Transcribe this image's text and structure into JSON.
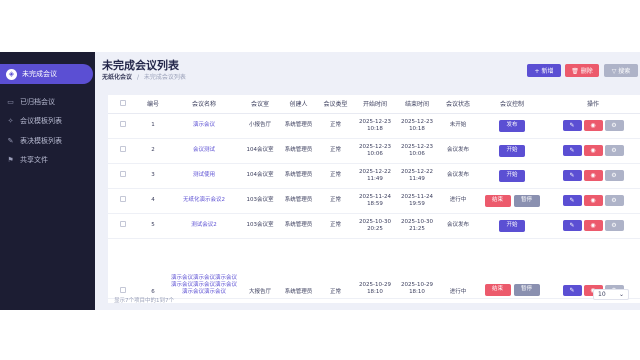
{
  "sidebar": {
    "items": [
      {
        "label": "未完成会议",
        "icon": "shield-icon",
        "glyph": "◈"
      },
      {
        "label": "已归档会议",
        "icon": "archive-icon",
        "glyph": "▭"
      },
      {
        "label": "会议模板列表",
        "icon": "bulb-icon",
        "glyph": "✧"
      },
      {
        "label": "表决模板列表",
        "icon": "vote-icon",
        "glyph": "✎"
      },
      {
        "label": "共享文件",
        "icon": "share-icon",
        "glyph": "⚑"
      }
    ]
  },
  "page": {
    "title": "未完成会议列表",
    "breadcrumb": [
      "无纸化会议",
      "未完成会议列表"
    ],
    "separator": "/"
  },
  "toolbar": {
    "add_label": "+ 新增",
    "delete_label": "🗑 删除",
    "search_label": "▽ 搜索"
  },
  "table": {
    "headers": [
      "",
      "编号",
      "会议名称",
      "会议室",
      "创建人",
      "会议类型",
      "开始时间",
      "结束时间",
      "会议状态",
      "会议控制",
      "操作"
    ],
    "rows": [
      {
        "no": "1",
        "name": "演示会议",
        "room": "小报告厅",
        "creator": "系统管理员",
        "type": "正常",
        "start": "2025-12-23 10:18",
        "end": "2025-12-23 10:18",
        "status": "未开始",
        "controls": [
          "发布"
        ]
      },
      {
        "no": "2",
        "name": "会议测试",
        "room": "104会议室",
        "creator": "系统管理员",
        "type": "正常",
        "start": "2025-12-23 10:06",
        "end": "2025-12-23 10:06",
        "status": "会议发布",
        "controls": [
          "开始"
        ]
      },
      {
        "no": "3",
        "name": "测试使用",
        "room": "104会议室",
        "creator": "系统管理员",
        "type": "正常",
        "start": "2025-12-22 11:49",
        "end": "2025-12-22 11:49",
        "status": "会议发布",
        "controls": [
          "开始"
        ]
      },
      {
        "no": "4",
        "name": "无纸化演示会议2",
        "room": "103会议室",
        "creator": "系统管理员",
        "type": "正常",
        "start": "2025-11-24 18:59",
        "end": "2025-11-24 19:59",
        "status": "进行中",
        "controls": [
          "结束",
          "暂停"
        ]
      },
      {
        "no": "5",
        "name": "测试会议2",
        "room": "103会议室",
        "creator": "系统管理员",
        "type": "正常",
        "start": "2025-10-30 20:25",
        "end": "2025-10-30 21:25",
        "status": "会议发布",
        "controls": [
          "开始"
        ]
      },
      {
        "no": "6",
        "name": "演示会议演示会议演示会议演示会议演示会议演示会议演示会议演示会议",
        "room": "大报告厅",
        "creator": "系统管理员",
        "type": "正常",
        "start": "2025-10-29 18:10",
        "end": "2025-10-29 18:10",
        "status": "进行中",
        "controls": [
          "结束",
          "暂停"
        ]
      }
    ]
  },
  "actions": {
    "edit_glyph": "✎",
    "view_glyph": "◉",
    "hook_glyph": "⚙"
  },
  "pagination": {
    "summary": "显示7个项目中的1到7个",
    "page_size": "10",
    "caret": "⌄"
  },
  "chat_glyph": "…"
}
